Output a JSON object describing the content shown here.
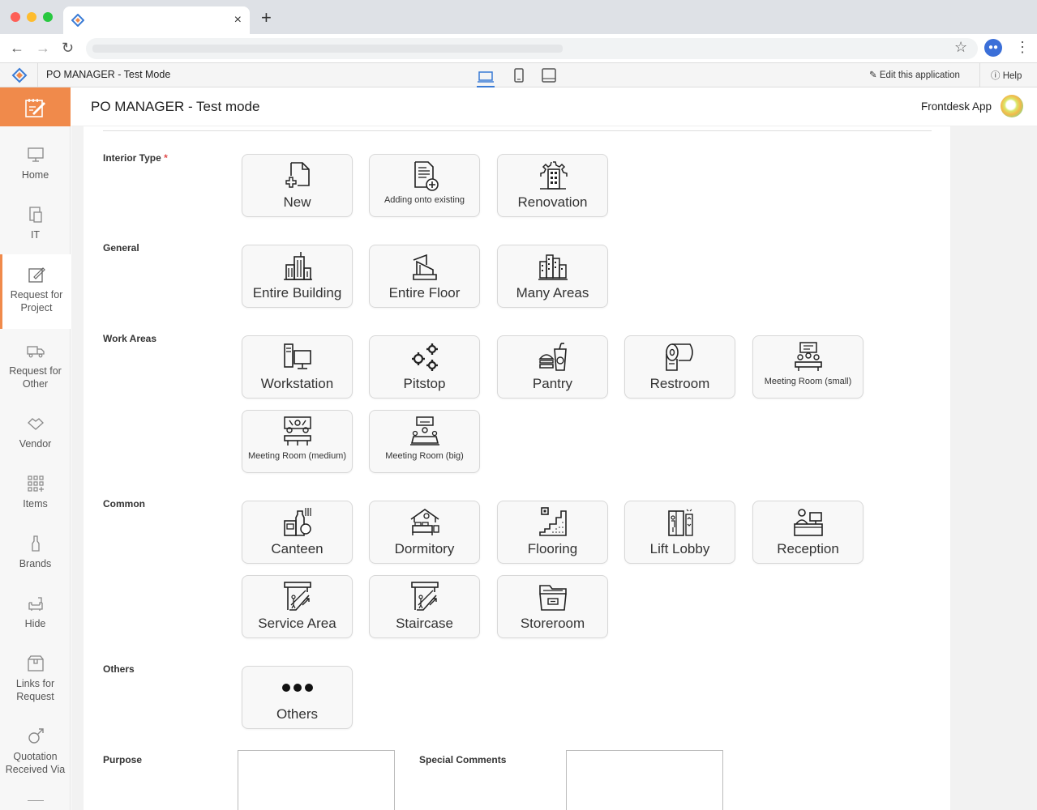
{
  "browser": {
    "tab_title": "",
    "new_tab": "+",
    "close_tab": "×"
  },
  "topbar": {
    "app_name": "PO MANAGER - Test Mode",
    "edit_app": "Edit this application",
    "help": "Help"
  },
  "header": {
    "title": "PO MANAGER - Test mode",
    "frontdesk": "Frontdesk App"
  },
  "sidebar": {
    "items": [
      {
        "label": "Home",
        "icon": "monitor-icon"
      },
      {
        "label": "IT",
        "icon": "devices-icon"
      },
      {
        "label": "Request for Project",
        "icon": "edit-box-icon",
        "active": true
      },
      {
        "label": "Request for Other",
        "icon": "truck-icon"
      },
      {
        "label": "Vendor",
        "icon": "handshake-icon"
      },
      {
        "label": "Items",
        "icon": "grid-plus-icon"
      },
      {
        "label": "Brands",
        "icon": "bottle-icon"
      },
      {
        "label": "Hide",
        "icon": "sofa-icon"
      },
      {
        "label": "Links for Request",
        "icon": "box-icon"
      },
      {
        "label": "Quotation Received Via",
        "icon": "male-icon"
      }
    ]
  },
  "form": {
    "sections": {
      "interior_type": "Interior Type",
      "required_mark": "*",
      "general": "General",
      "work_areas": "Work Areas",
      "common": "Common",
      "others": "Others",
      "purpose": "Purpose",
      "special_comments": "Special Comments"
    },
    "interior_type": [
      "New",
      "Adding onto existing",
      "Renovation"
    ],
    "general": [
      "Entire Building",
      "Entire Floor",
      "Many Areas"
    ],
    "work_areas": [
      "Workstation",
      "Pitstop",
      "Pantry",
      "Restroom",
      "Meeting Room (small)",
      "Meeting Room (medium)",
      "Meeting Room (big)"
    ],
    "common": [
      "Canteen",
      "Dormitory",
      "Flooring",
      "Lift Lobby",
      "Reception",
      "Service Area",
      "Staircase",
      "Storeroom"
    ],
    "others": [
      "Others"
    ]
  },
  "colors": {
    "accent": "#f08a4b",
    "active_device": "#3a7bd5",
    "required": "#e04a4a"
  }
}
